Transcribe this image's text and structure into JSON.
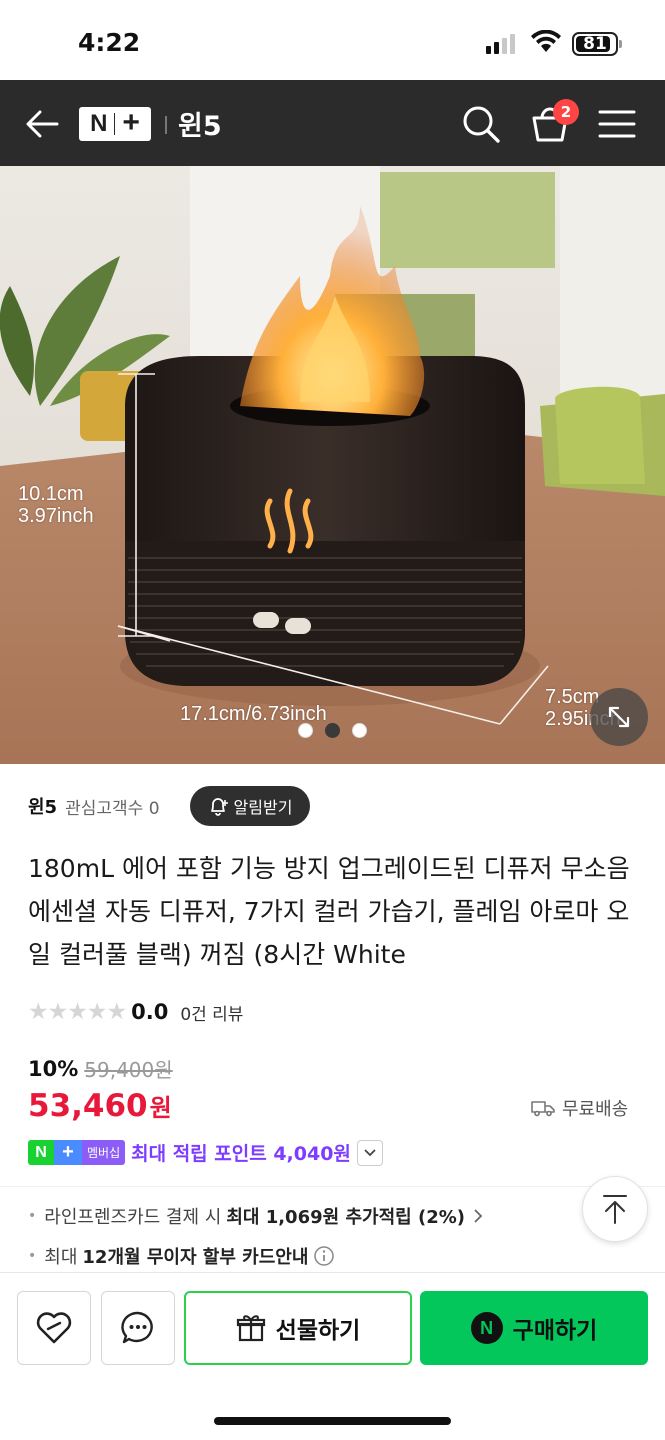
{
  "status_bar": {
    "time": "4:22",
    "battery": "81"
  },
  "header": {
    "logo_n": "N",
    "logo_plus": "+",
    "store_name": "윈5",
    "cart_count": "2"
  },
  "hero": {
    "height_label_cm": "10.1cm",
    "height_label_in": "3.97inch",
    "width_label": "17.1cm/6.73inch",
    "depth_label_cm": "7.5cm",
    "depth_label_in": "2.95inch",
    "carousel_total": 3,
    "carousel_active": 2
  },
  "store": {
    "name": "윈5",
    "fans": "관심고객수 0",
    "alarm_label": "알림받기"
  },
  "product": {
    "title": "180mL 에어 포함 기능 방지 업그레이드된 디퓨저 무소음 에센셜 자동 디퓨저, 7가지 컬러 가습기, 플레임 아로마 오일 컬러풀 블랙) 꺼짐 (8시간 White",
    "rating_stars": 0,
    "rating_score": "0.0",
    "review_count": "0건 리뷰"
  },
  "price": {
    "discount_rate": "10%",
    "original_price": "59,400원",
    "sale_price": "53,460",
    "unit": "원",
    "shipping": "무료배송"
  },
  "membership": {
    "badge_n": "N",
    "badge_plus": "+",
    "badge_label": "멤버십",
    "text": "최대 적립 포인트 4,040원"
  },
  "benefits": {
    "card_prefix": "라인프렌즈카드 결제 시",
    "card_bold": "최대 1,069원 추가적립 (2%)",
    "installment_prefix": "최대",
    "installment_bold": "12개월 무이자 할부 카드안내"
  },
  "bottom": {
    "gift_label": "선물하기",
    "buy_label": "구매하기",
    "npay": "N"
  },
  "colors": {
    "header_bg": "#2b2b2b",
    "sale_red": "#e8183a",
    "member_purple": "#7d3cff",
    "naver_green": "#03c75a"
  },
  "icons": [
    "back-arrow-icon",
    "search-icon",
    "cart-icon",
    "menu-icon",
    "expand-icon",
    "bell-icon",
    "truck-icon",
    "chevron-down-icon",
    "chevron-right-icon",
    "info-icon",
    "scroll-top-icon",
    "zzim-heart-icon",
    "talk-bubble-icon",
    "gift-icon",
    "npay-icon"
  ]
}
